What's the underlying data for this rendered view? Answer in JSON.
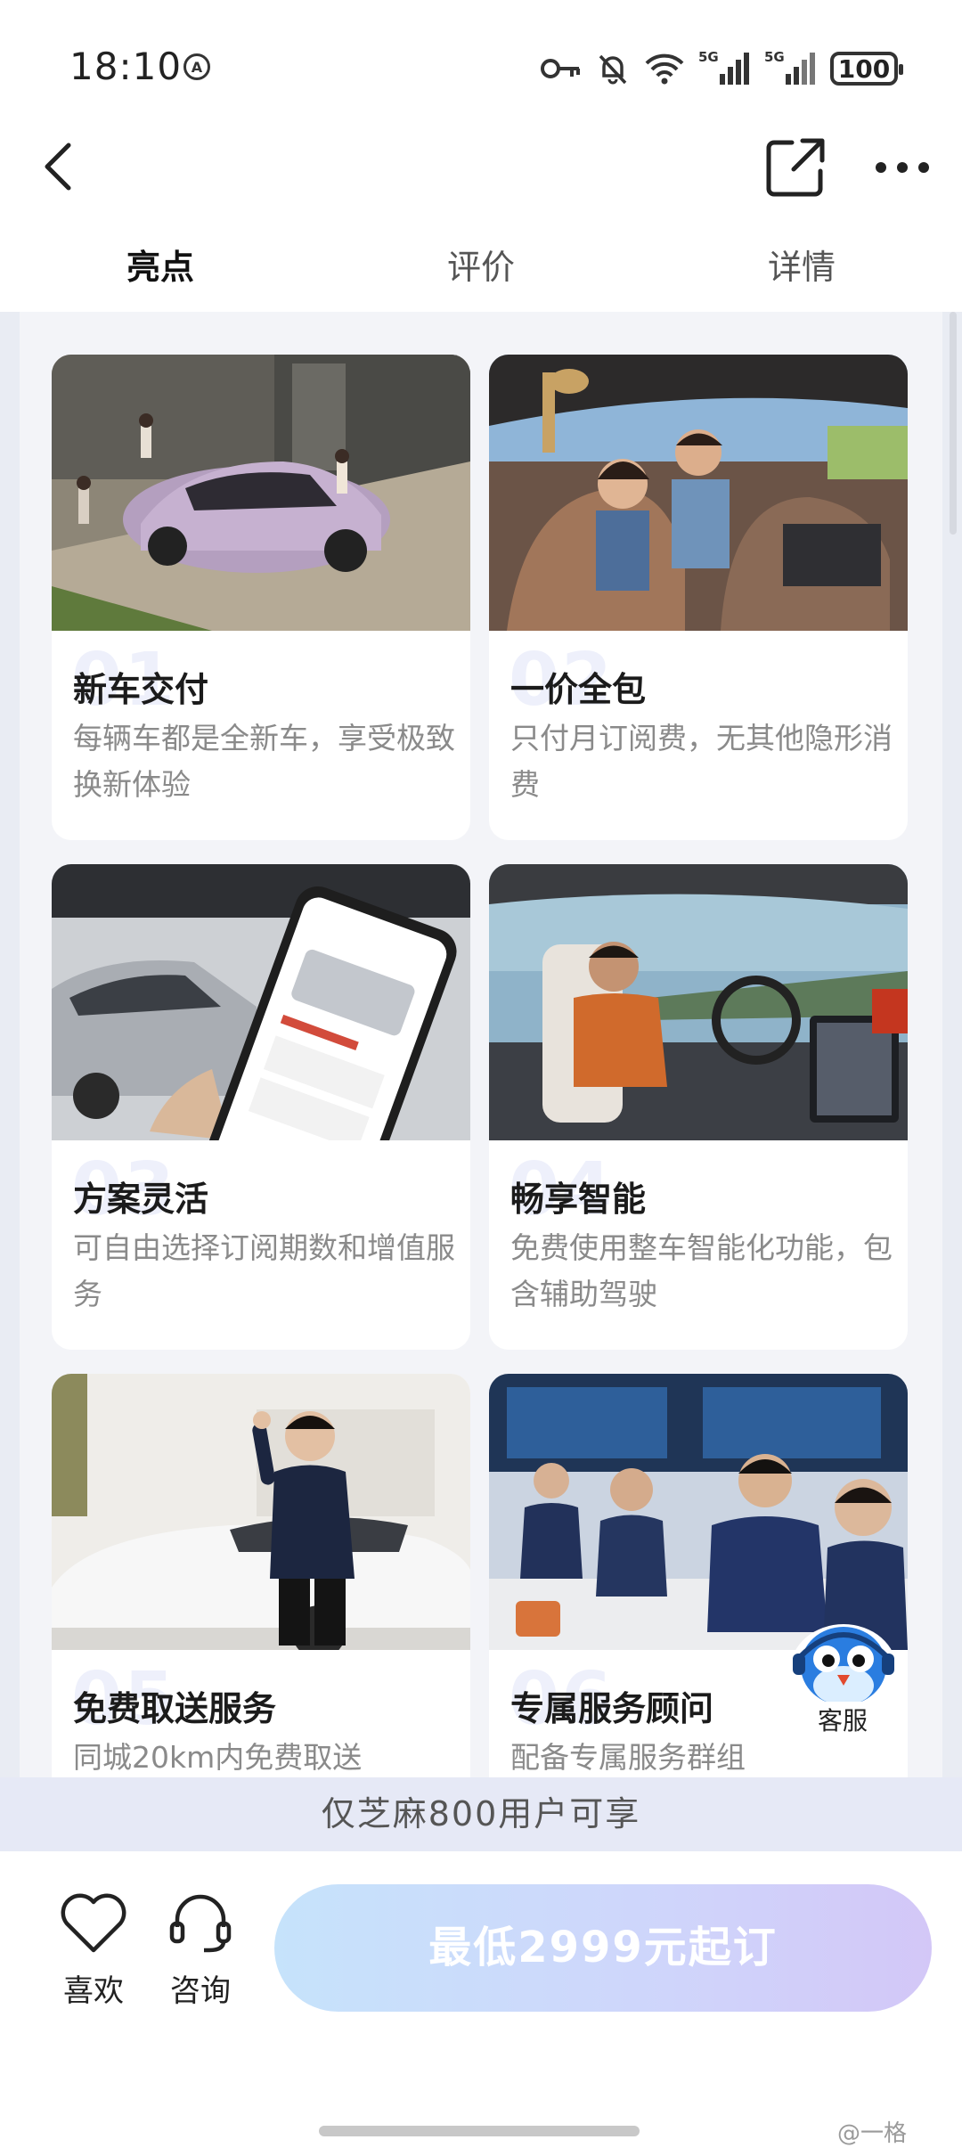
{
  "status_bar": {
    "time": "18:10",
    "a_icon_text": "A",
    "battery": "100"
  },
  "nav": {
    "back_icon": "chevron-left-icon",
    "share_icon": "share-icon",
    "more_icon": "more-icon"
  },
  "tabs": [
    {
      "label": "亮点",
      "active": true
    },
    {
      "label": "评价",
      "active": false
    },
    {
      "label": "详情",
      "active": false
    }
  ],
  "cards": [
    {
      "num": "01",
      "title": "新车交付",
      "desc": "每辆车都是全新车，享受极致换新体验"
    },
    {
      "num": "02",
      "title": "一价全包",
      "desc": "只付月订阅费，无其他隐形消费"
    },
    {
      "num": "03",
      "title": "方案灵活",
      "desc": "可自由选择订阅期数和增值服务"
    },
    {
      "num": "04",
      "title": "畅享智能",
      "desc": "免费使用整车智能化功能，包含辅助驾驶"
    },
    {
      "num": "05",
      "title": "免费取送服务",
      "desc": "同城20km内免费取送"
    },
    {
      "num": "06",
      "title": "专属服务顾问",
      "desc": "配备专属服务群组"
    }
  ],
  "customer_service": {
    "label": "客服"
  },
  "notice": "仅芝麻800用户可享",
  "bottom": {
    "favorite_label": "喜欢",
    "consult_label": "咨询",
    "cta_label": "最低2999元起订"
  },
  "watermark": "@一格",
  "colors": {
    "accent_gradient_start": "#c6e3fb",
    "accent_gradient_end": "#d3c7f7",
    "notice_bg": "#e6e9f6"
  }
}
